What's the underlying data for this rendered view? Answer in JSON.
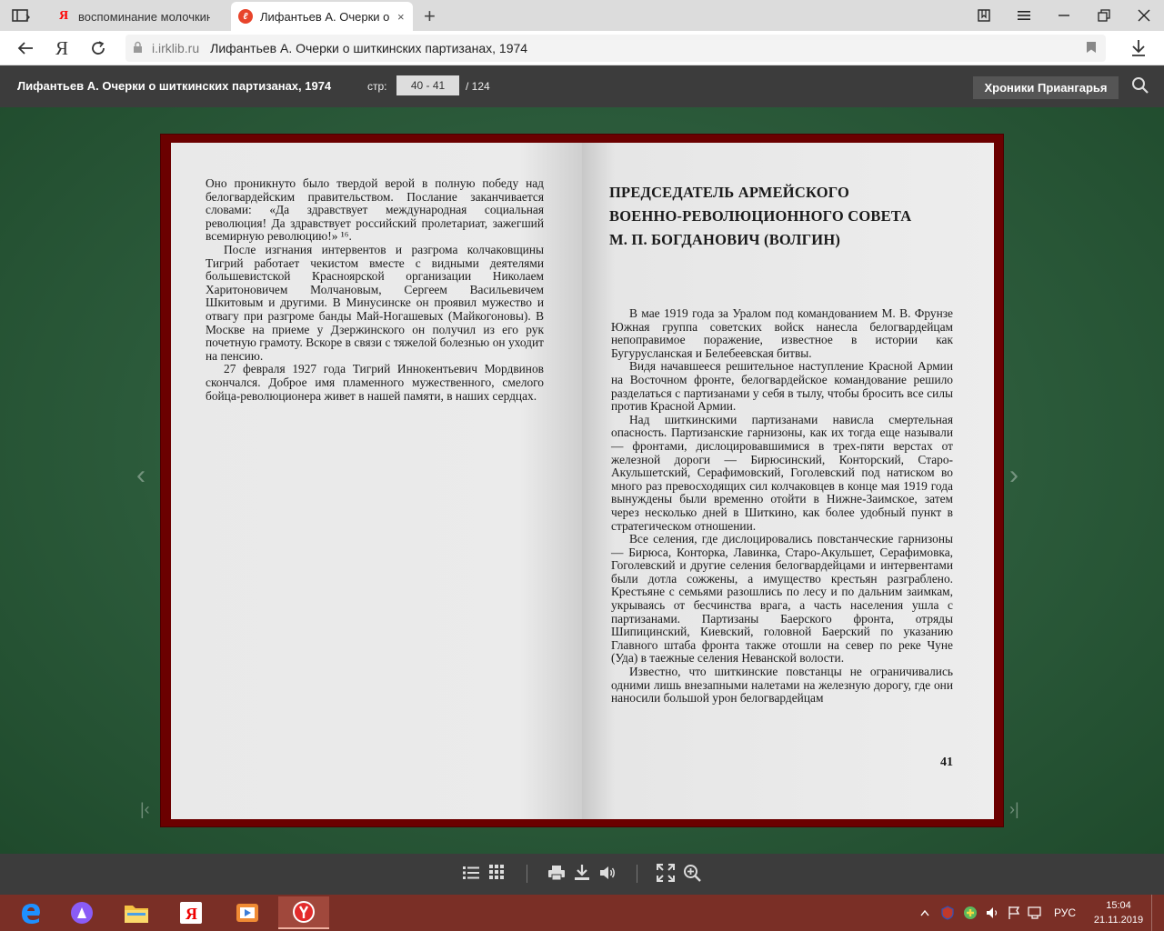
{
  "browser": {
    "tabs": [
      {
        "title": "воспоминание молочкина",
        "favicon": "yandex",
        "active": false
      },
      {
        "title": "Лифантьев А. Очерки о",
        "favicon": "irklib",
        "active": true
      }
    ],
    "close_glyph": "×",
    "new_tab_glyph": "+",
    "address": {
      "domain": "i.irklib.ru",
      "page_title": "Лифантьев А. Очерки о шиткинских партизанах, 1974"
    }
  },
  "header": {
    "book_title": "Лифантьев А. Очерки о шиткинских партизанах, 1974",
    "page_label": "стр:",
    "page_value": "40 - 41",
    "page_total": "/   124",
    "collection_button": "Хроники Приангарья"
  },
  "book": {
    "left_page_paragraphs": [
      "Оно проникнуто было твердой верой в полную победу над белогвардейским правительством. Послание заканчивается словами: «Да здравствует международная социальная революция! Да здравствует российский пролетариат, зажегший всемирную революцию!» ¹⁶.",
      "После изгнания интервентов и разгрома колчаковщины Тигрий работает чекистом вместе с видными деятелями большевистской Красноярской организации Николаем Харитоновичем Молчановым, Сергеем Васильевичем Шкитовым и другими. В Минусинске он проявил мужество и отвагу при разгроме банды Май-Ногашевых (Майкогоновы). В Москве на приеме у Дзержинского он получил из его рук почетную грамоту. Вскоре в связи с тяжелой болезнью он уходит на пенсию.",
      "27 февраля 1927 года Тигрий Иннокентьевич Мордвинов скончался. Доброе имя пламенного мужественного, смелого бойца-революционера живет в нашей памяти, в наших сердцах."
    ],
    "chapter_title_lines": [
      "ПРЕДСЕДАТЕЛЬ АРМЕЙСКОГО",
      "ВОЕННО-РЕВОЛЮЦИОННОГО СОВЕТА",
      "М. П. БОГДАНОВИЧ (ВОЛГИН)"
    ],
    "right_page_paragraphs": [
      "В мае 1919 года за Уралом под командованием М. В. Фрунзе Южная группа советских войск нанесла белогвардейцам непоправимое поражение, известное в истории как Бугурусланская и Белебеевская битвы.",
      "Видя начавшееся решительное наступление Красной Армии на Восточном фронте, белогвардейское командование решило разделаться с партизанами у себя в тылу, чтобы бросить все силы против Красной Армии.",
      "Над шиткинскими партизанами нависла смертельная опасность. Партизанские гарнизоны, как их тогда еще называли — фронтами, дислоцировавшимися в трех-пяти верстах от железной дороги — Бирюсинский, Конторский, Старо-Акульшетский, Серафимовский, Гоголевский под натиском во много раз превосходящих сил колчаковцев в конце мая 1919 года вынуждены были временно отойти в Нижне-Заимское, затем через несколько дней в Шиткино, как более удобный пункт в стратегическом отношении.",
      "Все селения, где дислоцировались повстанческие гарнизоны — Бирюса, Конторка, Лавинка, Старо-Акульшет, Серафимовка, Гоголевский и другие селения белогвардейцами и интервентами были дотла сожжены, а имущество крестьян разграблено. Крестьяне с семьями разошлись по лесу и по дальним заимкам, укрываясь от бесчинства врага, а часть населения ушла с партизанами. Партизаны Баерского фронта, отряды Шипицинский, Киевский, головной Баерский по указанию Главного штаба фронта также отошли на север по реке Чуне (Уда) в таежные селения Неванской волости.",
      "Известно, что шиткинские повстанцы не ограничивались одними лишь внезапными налетами на железную дорогу, где они наносили большой урон белогвардейцам"
    ],
    "right_page_number": "41"
  },
  "taskbar": {
    "language": "РУС",
    "time": "15:04",
    "date": "21.11.2019"
  },
  "colors": {
    "accent_dark": "#3c3c3c",
    "book_frame": "#6b0000",
    "taskbar": "#7a2f26",
    "background": "#2d5a3c"
  }
}
